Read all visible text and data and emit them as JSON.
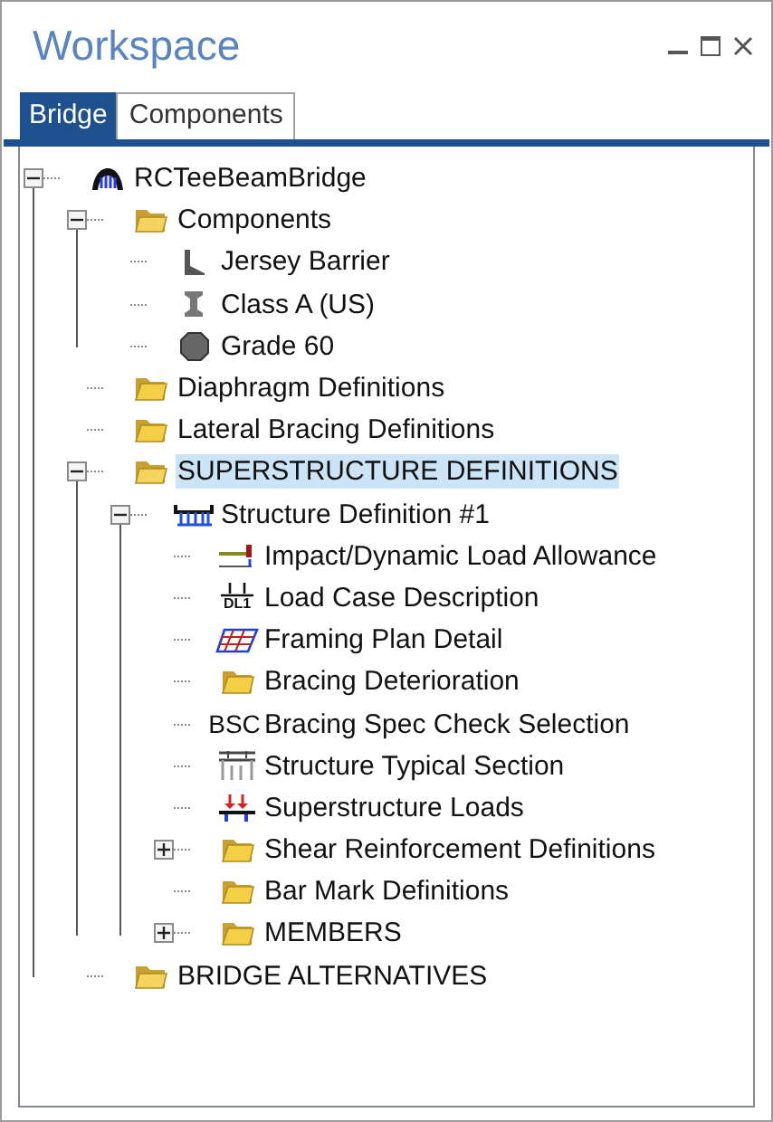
{
  "window": {
    "title": "Workspace"
  },
  "tabs": [
    {
      "label": "Bridge",
      "selected": true
    },
    {
      "label": "Components",
      "selected": false
    }
  ],
  "tree": [
    {
      "label": "RCTeeBeamBridge",
      "kind": "bridge",
      "selected": false,
      "expanded": true,
      "children": [
        {
          "label": "Components",
          "kind": "openfolder",
          "selected": false,
          "expanded": true,
          "children": [
            {
              "label": "Jersey Barrier",
              "kind": "barrier",
              "selected": false
            },
            {
              "label": "Class A (US)",
              "kind": "beam",
              "selected": false
            },
            {
              "label": "Grade 60",
              "kind": "rebar",
              "selected": false
            }
          ]
        },
        {
          "label": "Diaphragm Definitions",
          "kind": "folder",
          "selected": false
        },
        {
          "label": "Lateral Bracing Definitions",
          "kind": "folder",
          "selected": false
        },
        {
          "label": "SUPERSTRUCTURE DEFINITIONS",
          "kind": "openfolder",
          "selected": true,
          "expanded": true,
          "children": [
            {
              "label": "Structure Definition #1",
              "kind": "structure",
              "selected": false,
              "expanded": true,
              "children": [
                {
                  "label": "Impact/Dynamic Load Allowance",
                  "kind": "impact",
                  "selected": false
                },
                {
                  "label": "Load Case Description",
                  "kind": "loadcase",
                  "icon_text": "DL1",
                  "selected": false
                },
                {
                  "label": "Framing Plan Detail",
                  "kind": "framing",
                  "selected": false
                },
                {
                  "label": "Bracing Deterioration",
                  "kind": "folder",
                  "selected": false
                },
                {
                  "label": "Bracing Spec Check Selection",
                  "kind": "abbrev",
                  "icon_text": "BSC",
                  "selected": false
                },
                {
                  "label": "Structure Typical Section",
                  "kind": "section",
                  "selected": false
                },
                {
                  "label": "Superstructure Loads",
                  "kind": "loads",
                  "selected": false
                },
                {
                  "label": "Shear Reinforcement Definitions",
                  "kind": "folder",
                  "selected": false,
                  "expanded": false
                },
                {
                  "label": "Bar Mark Definitions",
                  "kind": "folder",
                  "selected": false
                },
                {
                  "label": "MEMBERS",
                  "kind": "folder",
                  "selected": false,
                  "expanded": false
                }
              ]
            }
          ]
        },
        {
          "label": "BRIDGE ALTERNATIVES",
          "kind": "openfolder",
          "selected": false
        }
      ]
    }
  ]
}
